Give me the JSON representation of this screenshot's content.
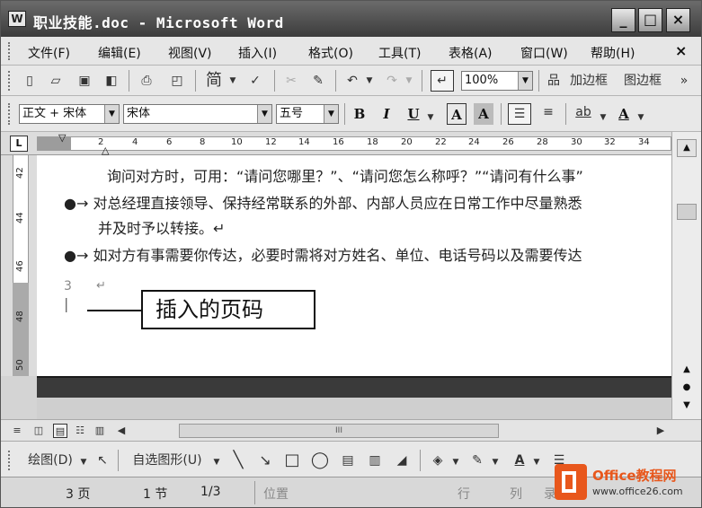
{
  "window": {
    "title": "职业技能.doc - Microsoft Word",
    "min_icon": "minimize-icon",
    "max_icon": "maximize-icon",
    "close_icon": "close-icon"
  },
  "menu": [
    "文件(F)",
    "编辑(E)",
    "视图(V)",
    "插入(I)",
    "格式(O)",
    "工具(T)",
    "表格(A)",
    "窗口(W)",
    "帮助(H)"
  ],
  "menu_close": "×",
  "standard_toolbar": {
    "jian_label": "简",
    "zoom": "100%",
    "add_border": "加边框",
    "image_border": "图边框"
  },
  "format_toolbar": {
    "style": "正文 + 宋体",
    "font": "宋体",
    "size": "五号",
    "bold": "B",
    "italic": "I",
    "underline": "U",
    "char_border": "A",
    "char_shade": "A",
    "font_color": "A"
  },
  "ruler": {
    "corner": "L",
    "ticks": [
      "2",
      "4",
      "6",
      "8",
      "10",
      "12",
      "14",
      "16",
      "18",
      "20",
      "22",
      "24",
      "26",
      "28",
      "30",
      "32",
      "34"
    ],
    "vticks": [
      "42",
      "44",
      "46",
      "48",
      "50"
    ]
  },
  "document": {
    "line1": "询问对方时，可用：“请问您哪里？”、“请问您怎么称呼？”“请问有什么事”",
    "bullet2": "●→ 对总经理直接领导、保持经常联系的外部、内部人员应在日常工作中尽量熟悉",
    "line3": "并及时予以转接。↵",
    "bullet4": "●→ 如对方有事需要你传达，必要时需将对方姓名、单位、电话号码以及需要传达",
    "page_number": "3",
    "return_mark": "↵",
    "callout": "插入的页码"
  },
  "hscroll_grip": "III",
  "draw_toolbar": {
    "draw": "绘图(D)",
    "autoshapes": "自选图形(U)"
  },
  "status": {
    "page": "3 页",
    "section": "1 节",
    "pages": "1/3",
    "position": "位置",
    "row": "行",
    "col": "列",
    "rec": "录"
  },
  "watermark": {
    "brand": "Office教程网",
    "url": "www.office26.com"
  }
}
